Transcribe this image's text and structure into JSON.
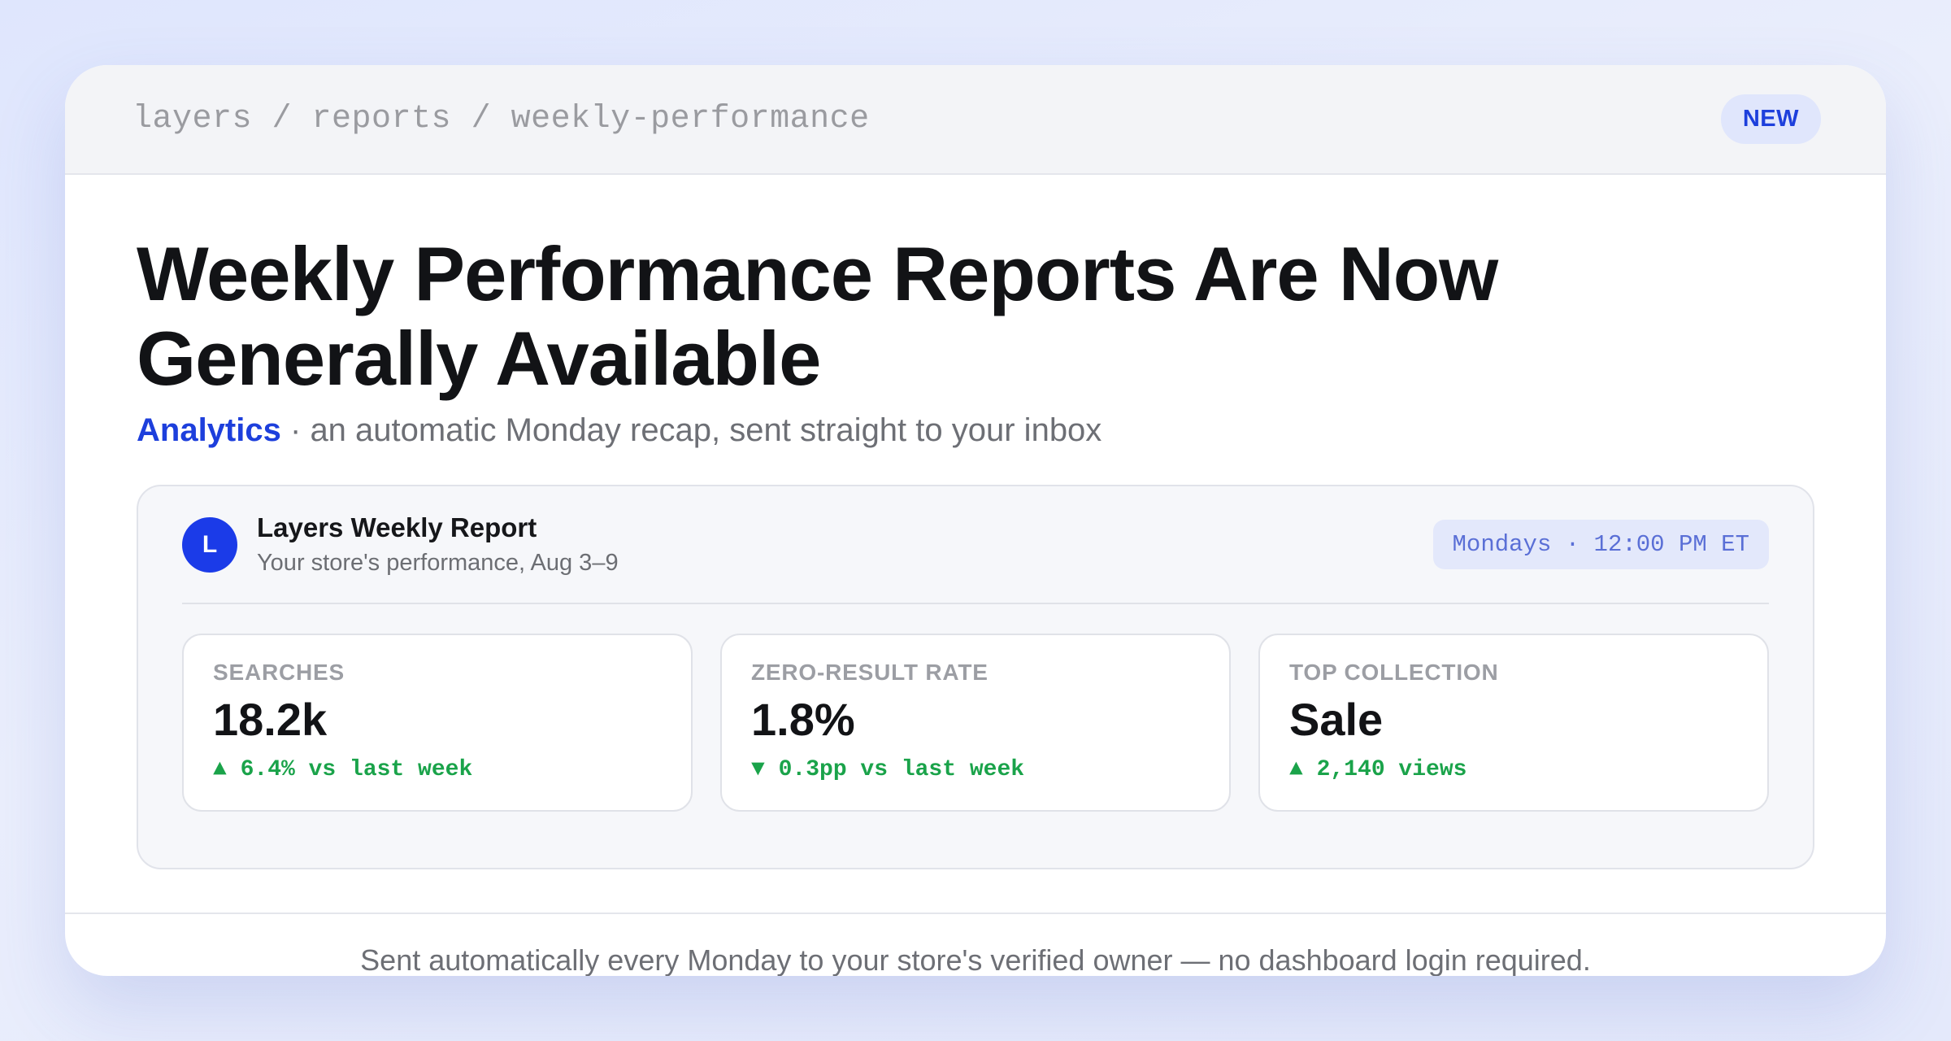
{
  "breadcrumb": "layers / reports / weekly-performance",
  "badge": "NEW",
  "headline": {
    "title": "Weekly Performance Reports Are Now Generally Available",
    "category": "Analytics",
    "separator": "·",
    "tagline": "an automatic Monday recap, sent straight to your inbox"
  },
  "report": {
    "avatar_letter": "L",
    "name": "Layers Weekly Report",
    "range": "Your store's performance, Aug 3–9",
    "schedule": "Mondays · 12:00 PM ET",
    "metrics": [
      {
        "label": "SEARCHES",
        "value": "18.2k",
        "delta": "▲ 6.4% vs last week"
      },
      {
        "label": "ZERO-RESULT RATE",
        "value": "1.8%",
        "delta": "▼ 0.3pp vs last week"
      },
      {
        "label": "TOP COLLECTION",
        "value": "Sale",
        "delta": "▲ 2,140 views"
      }
    ]
  },
  "footer": "Sent automatically every Monday to your store's verified owner — no dashboard login required.",
  "colors": {
    "accent": "#1d3fdc",
    "positive": "#1aa34a",
    "background": "#e4e9fb"
  }
}
